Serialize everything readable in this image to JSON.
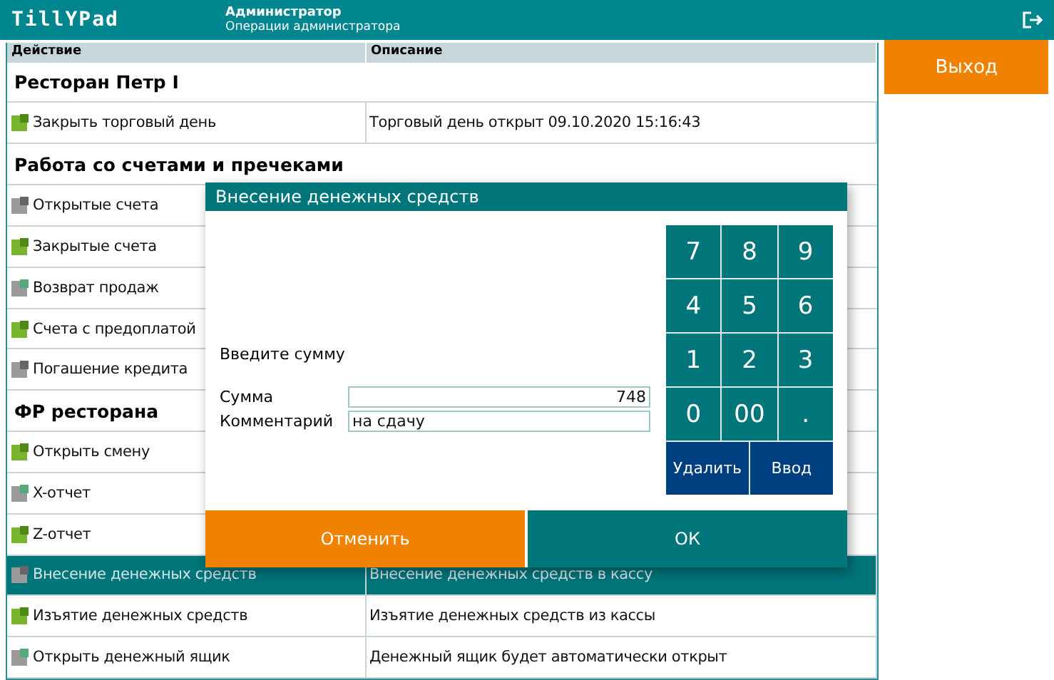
{
  "header": {
    "logo": "TillYPad",
    "user": "Администратор",
    "subtitle": "Операции администратора"
  },
  "table": {
    "columns": [
      "Действие",
      "Описание"
    ],
    "groups": [
      {
        "title": "Ресторан Петр I",
        "items": [
          {
            "label": "Закрыть торговый день",
            "description": "Торговый день открыт 09.10.2020 15:16:43",
            "selected": false
          }
        ]
      },
      {
        "title": "Работа со счетами и пречеками",
        "items": [
          {
            "label": "Открытые счета",
            "selected": false
          },
          {
            "label": "Закрытые счета",
            "selected": false
          },
          {
            "label": "Возврат продаж",
            "selected": false
          },
          {
            "label": "Счета с предоплатой",
            "selected": false
          },
          {
            "label": "Погашение кредита",
            "selected": false
          }
        ]
      },
      {
        "title": "ФР ресторана",
        "items": [
          {
            "label": "Открыть смену",
            "selected": false
          },
          {
            "label": "X-отчет",
            "selected": false
          },
          {
            "label": "Z-отчет",
            "selected": false
          },
          {
            "label": "Внесение денежных средств",
            "description": "Внесение денежных средств в кассу",
            "selected": true
          },
          {
            "label": "Изъятие денежных средств",
            "description": "Изъятие денежных средств из кассы",
            "selected": false
          },
          {
            "label": "Открыть денежный ящик",
            "description": "Денежный ящик будет автоматически открыт",
            "selected": false
          }
        ]
      }
    ]
  },
  "exit_button": "Выход",
  "dialog": {
    "title": "Внесение денежных средств",
    "prompt": "Введите сумму",
    "fields": [
      {
        "label": "Сумма",
        "value": "748",
        "kind": "number"
      },
      {
        "label": "Комментарий",
        "value": "на сдачу",
        "kind": "text"
      }
    ],
    "keypad": [
      "7",
      "8",
      "9",
      "4",
      "5",
      "6",
      "1",
      "2",
      "3",
      "0",
      "00",
      "."
    ],
    "keypad_actions": [
      "Удалить",
      "Ввод"
    ],
    "cancel": "Отменить",
    "ok": "ОК"
  }
}
